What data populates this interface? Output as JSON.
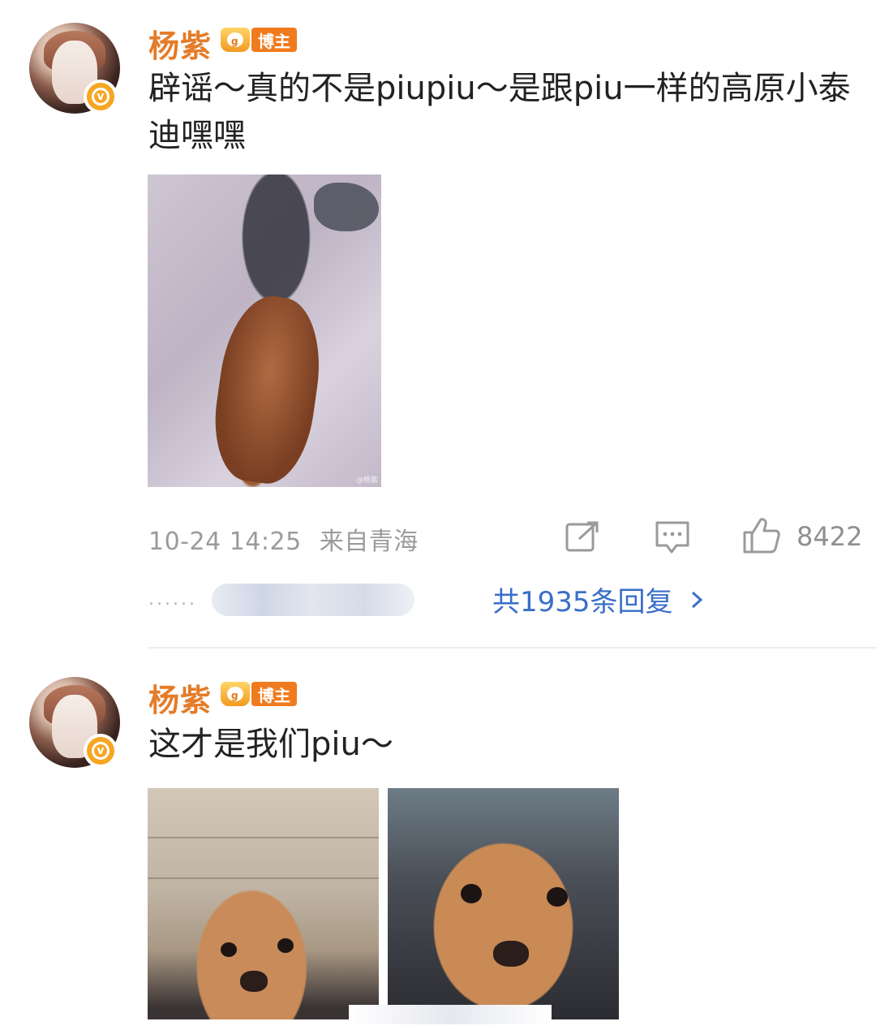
{
  "posts": [
    {
      "username": "杨紫",
      "badge_label": "博主",
      "text": "辟谣～真的不是piupiu～是跟piu一样的高原小泰迪嘿嘿",
      "time": "10-24 14:25",
      "location": "来自青海",
      "likes": "8422",
      "replies_label": "共1935条回复",
      "photo_watermark": "@杨紫"
    },
    {
      "username": "杨紫",
      "badge_label": "博主",
      "text": "这才是我们piu～"
    }
  ],
  "icons": {
    "verified": "verified-v-icon",
    "share": "share-icon",
    "comment": "comment-icon",
    "like": "thumbs-up-icon",
    "chevron": "chevron-right-icon"
  },
  "colors": {
    "username": "#e47c29",
    "link": "#3a6ec8",
    "meta": "#9b9b9b",
    "badge": "#f07b1e"
  }
}
